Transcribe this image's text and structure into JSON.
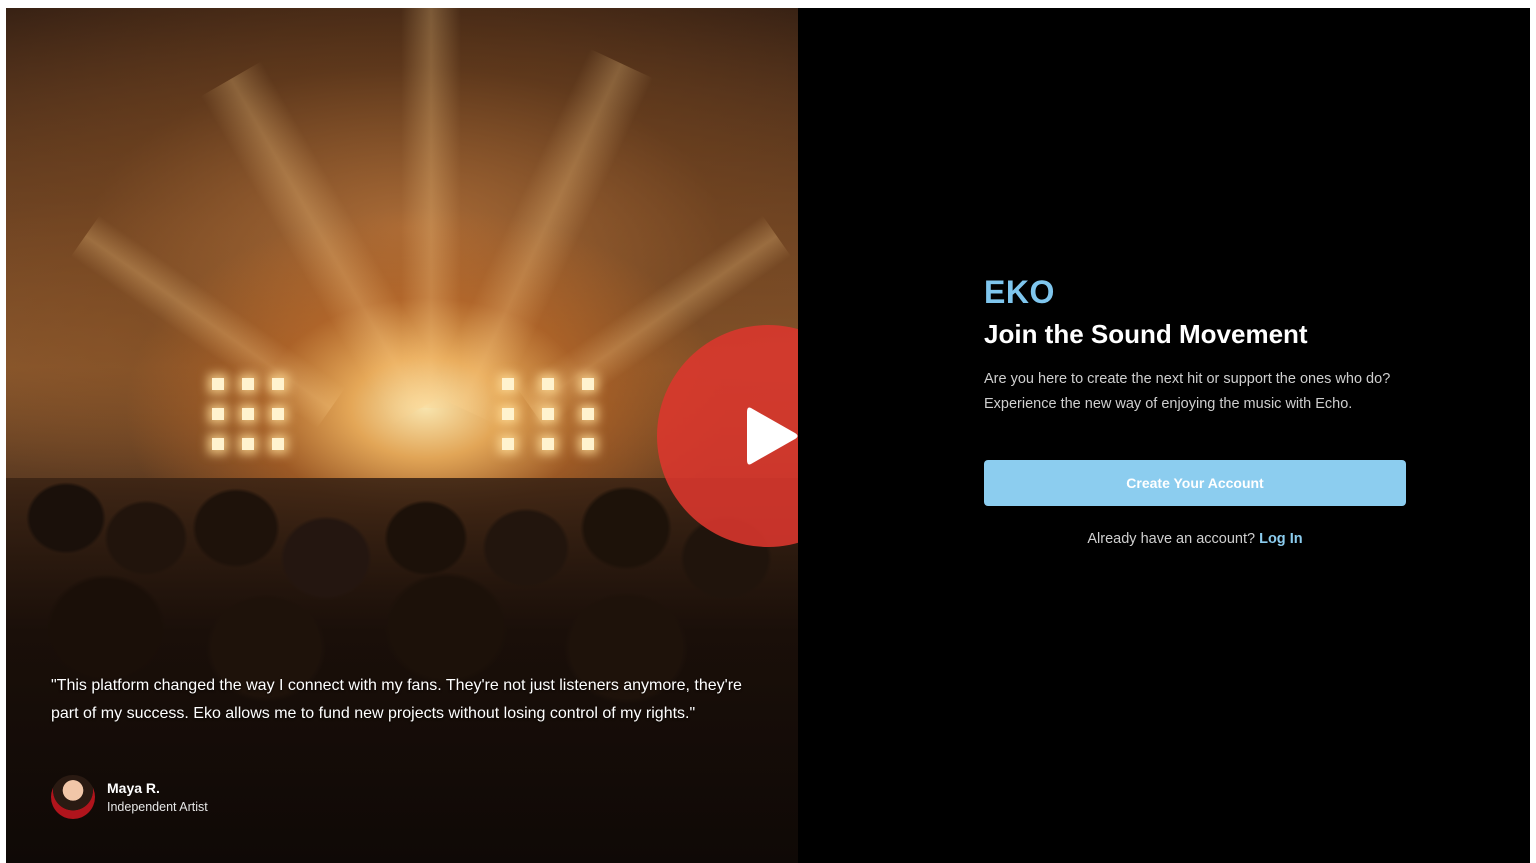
{
  "hero": {
    "testimonial": "\"This platform changed the way I connect with my fans. They're not just listeners anymore, they're part of my success. Eko allows me to fund new projects without losing control of my rights.\"",
    "author_name": "Maya R.",
    "author_role": "Independent Artist"
  },
  "video": {
    "play_icon": "play-icon",
    "accent_color": "#dc372d"
  },
  "signup": {
    "brand": "EKO",
    "headline": "Join the Sound Movement",
    "description": "Are you here to create the next hit or support the ones who do? Experience the new way of enjoying the music with Echo.",
    "cta_label": "Create Your Account",
    "login_prompt": "Already have an account?",
    "login_label": "Log In",
    "brand_color": "#7fc6ee",
    "button_color": "#8ccdef"
  }
}
